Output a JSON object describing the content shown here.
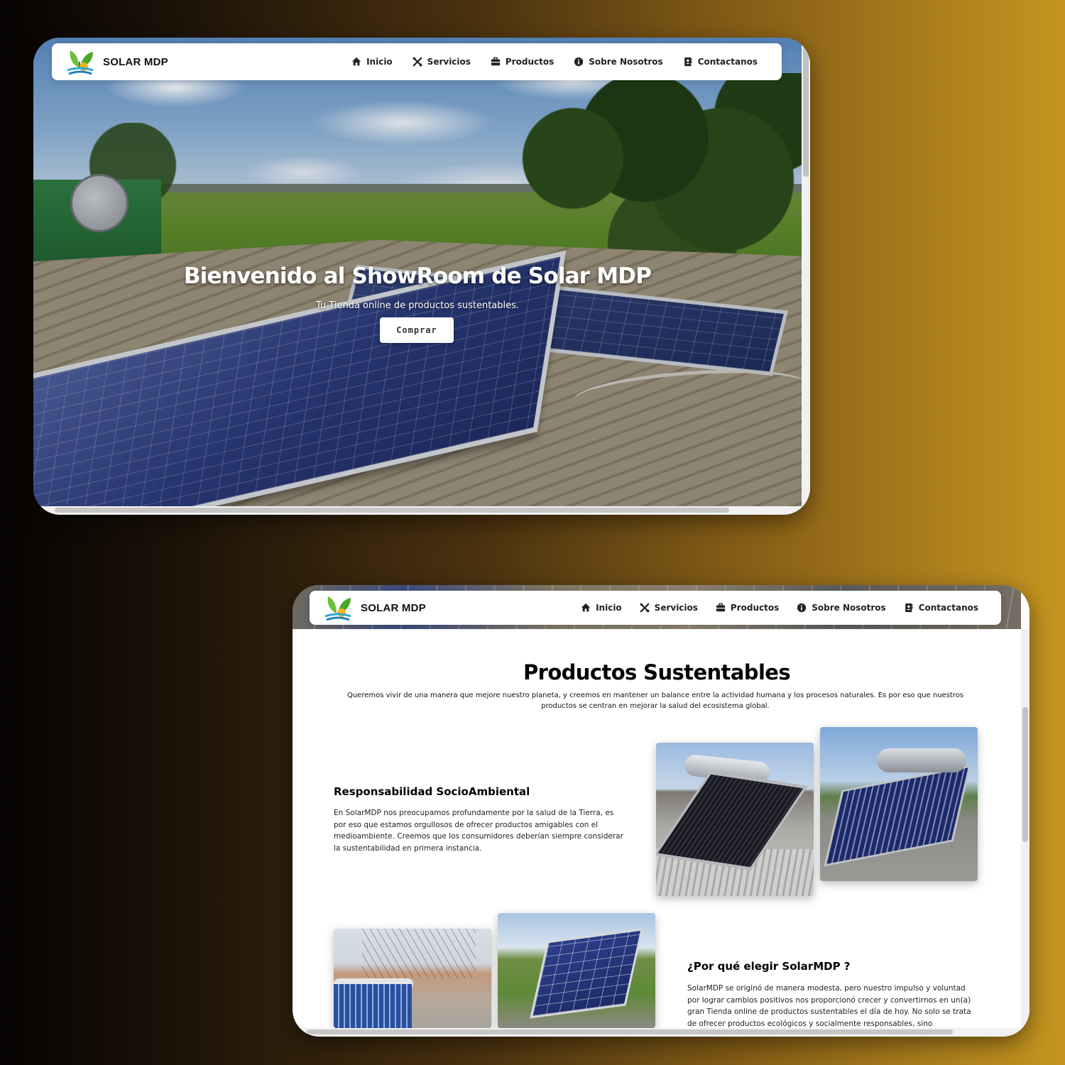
{
  "brand": {
    "name": "SOLAR MDP",
    "logo_icon": "solar-leaf-logo-icon"
  },
  "nav": [
    {
      "label": "Inicio",
      "icon": "home-icon"
    },
    {
      "label": "Servicios",
      "icon": "tools-icon"
    },
    {
      "label": "Productos",
      "icon": "briefcase-icon"
    },
    {
      "label": "Sobre Nosotros",
      "icon": "info-icon"
    },
    {
      "label": "Contactanos",
      "icon": "contact-card-icon"
    }
  ],
  "hero": {
    "title": "Bienvenido al ShowRoom de Solar MDP",
    "subtitle": "Tu Tienda online de productos sustentables.",
    "cta": "Comprar"
  },
  "products": {
    "title": "Productos Sustentables",
    "intro": "Queremos vivir de una manera que mejore nuestro planeta, y creemos en mantener un balance entre la actividad humana y los procesos naturales. Es por eso que nuestros productos se centran en mejorar la salud del ecosistema global.",
    "block1": {
      "title": "Responsabilidad SocioAmbiental",
      "text": "En SolarMDP nos preocupamos profundamente por la salud de la Tierra, es por eso que estamos orgullosos de ofrecer productos amigables con el medioambiente. Creemos que los consumidores deberían siempre considerar la sustentabilidad en primera instancia."
    },
    "block2": {
      "title": "¿Por qué elegir SolarMDP ?",
      "text": "SolarMDP se originó de manera modesta, pero nuestro impulso y voluntad por lograr cambios positivos nos proporcionó crecer y convertirnos en un(a) gran Tienda online de productos sustentables el día de hoy. No solo se trata de ofrecer productos ecológicos y socialmente responsables, sino"
    }
  },
  "colors": {
    "background_dark": "#050302",
    "background_gold": "#c49520",
    "card": "#ffffff",
    "text": "#111111"
  }
}
